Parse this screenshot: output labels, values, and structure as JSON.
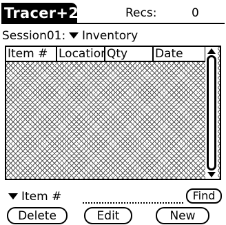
{
  "app": {
    "title": "Tracer+2",
    "records_label": "Recs:",
    "records_count": "0"
  },
  "session": {
    "label": "Session01:",
    "selected_view": "Inventory"
  },
  "table": {
    "columns": [
      "Item #",
      "Location",
      "Qty",
      "Date"
    ],
    "rows": []
  },
  "search": {
    "field": "Item #",
    "value": "",
    "find_label": "Find"
  },
  "buttons": {
    "delete_label": "Delete",
    "edit_label": "Edit",
    "new_label": "New"
  },
  "icons": {
    "dropdown": "triangle-down-icon",
    "scroll_up": "arrow-up-icon",
    "scroll_down": "arrow-down-icon"
  }
}
